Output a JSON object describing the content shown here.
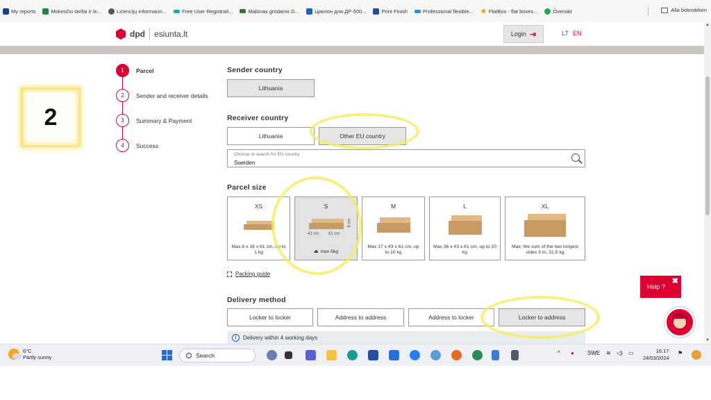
{
  "bookmarks": {
    "items": [
      {
        "label": "My reports",
        "icon": "kd-icon",
        "color": "#1b3f8b"
      },
      {
        "label": "Mokesčio tarifai ir le...",
        "icon": "sheet-icon",
        "color": "#1e8a3a"
      },
      {
        "label": "Licencijų informacin...",
        "icon": "globe-icon",
        "color": "#555555"
      },
      {
        "label": "Free User Registrati...",
        "icon": "link-icon",
        "color": "#2aa5a0"
      },
      {
        "label": "Malūnas grūdams G...",
        "icon": "mill-icon",
        "color": "#2a7a2a"
      },
      {
        "label": "Циклон для ДР-500...",
        "icon": "m-icon",
        "color": "#1f5fbf"
      },
      {
        "label": "Print Finish",
        "icon": "print-icon",
        "color": "#1f4fa0"
      },
      {
        "label": "Professional flexible...",
        "icon": "wave-icon",
        "color": "#3a8ad6"
      },
      {
        "label": "FlatBox - flat boxes...",
        "icon": "star-icon",
        "color": "#e0a400"
      },
      {
        "label": "Översikt",
        "icon": "overview-icon",
        "color": "#2aa54a"
      }
    ],
    "all_label": "Alla bokmärken"
  },
  "header": {
    "brand": "dpd",
    "site": "esiunta.lt",
    "login_label": "Login",
    "lang_lt": "LT",
    "lang_en": "EN",
    "brand_color": "#dc0032"
  },
  "annotation": {
    "number": "2"
  },
  "stepper": {
    "steps": [
      {
        "num": "1",
        "label": "Parcel",
        "active": true
      },
      {
        "num": "2",
        "label": "Sender and receiver details",
        "active": false
      },
      {
        "num": "3",
        "label": "Summary & Payment",
        "active": false
      },
      {
        "num": "4",
        "label": "Success",
        "active": false
      }
    ]
  },
  "form": {
    "sender": {
      "title": "Sender country",
      "selected": "Lithuania"
    },
    "receiver": {
      "title": "Receiver country",
      "options": [
        {
          "label": "Lithuania",
          "selected": false
        },
        {
          "label": "Other EU country",
          "selected": true
        }
      ],
      "search_placeholder": "Choose or search for EU country",
      "search_value": "Sweden"
    },
    "parcel_size": {
      "title": "Parcel size",
      "sizes": [
        {
          "label": "XS",
          "desc": "Max 8 x 18 x 61 cm, up to 1 kg",
          "selected": false
        },
        {
          "label": "S",
          "desc": "max 5kg",
          "selected": true,
          "dims": {
            "w": "43 cm",
            "d": "61 cm",
            "h": "8 cm"
          }
        },
        {
          "label": "M",
          "desc": "Max 17 x 43 x 61 cm, up to 10 kg",
          "selected": false
        },
        {
          "label": "L",
          "desc": "Max 36 x 43 x 61 cm, up to 20 kg",
          "selected": false
        },
        {
          "label": "XL",
          "desc": "Max: the sum of the two longest sides 3 m, 31,5 kg",
          "selected": false
        }
      ],
      "packing_guide": "Packing guide"
    },
    "delivery": {
      "title": "Delivery method",
      "options": [
        {
          "label": "Locker to locker",
          "selected": false
        },
        {
          "label": "Address to address",
          "selected": false
        },
        {
          "label": "Address to locker",
          "selected": false
        },
        {
          "label": "Locker to address",
          "selected": true
        }
      ],
      "info": "Delivery within 4 working days"
    }
  },
  "help": {
    "label": "Help ?",
    "close": "✖"
  },
  "taskbar": {
    "temperature": "6°C",
    "weather": "Partly sunny",
    "search_label": "Search",
    "lang": "SWE",
    "time": "16:17",
    "date": "24/03/2024",
    "apps": [
      {
        "name": "copilot-people-icon",
        "color": "#6b7fb0"
      },
      {
        "name": "taskview-icon",
        "color": "#333333"
      },
      {
        "name": "teams-icon",
        "color": "#5b5fc7"
      },
      {
        "name": "file-explorer-icon",
        "color": "#f2c14e"
      },
      {
        "name": "edge-icon",
        "color": "#1a9b8e"
      },
      {
        "name": "m-app-icon",
        "color": "#2a4ba0"
      },
      {
        "name": "store-icon",
        "color": "#2a6fd6"
      },
      {
        "name": "chrome-icon",
        "color": "#2b7de9"
      },
      {
        "name": "paint-icon",
        "color": "#5aa0d6"
      },
      {
        "name": "chrome-profile-icon",
        "color": "#e56b1f"
      },
      {
        "name": "chrome-alt-icon",
        "color": "#2d8a4e"
      },
      {
        "name": "notepad-icon",
        "color": "#3a7bd5"
      },
      {
        "name": "calculator-icon",
        "color": "#555b66"
      }
    ]
  }
}
